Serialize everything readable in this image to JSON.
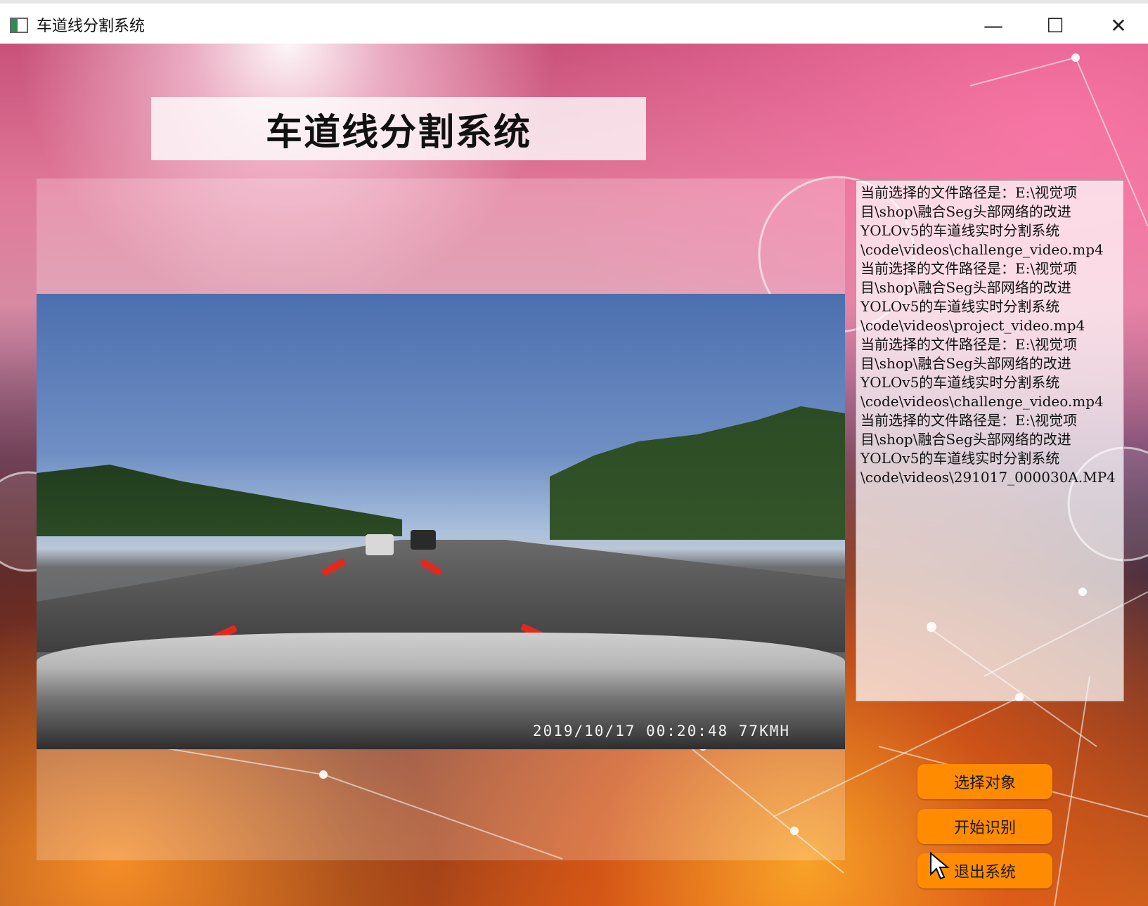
{
  "window": {
    "title": "车道线分割系统",
    "controls": {
      "minimize": "—",
      "maximize": "☐",
      "close": "✕"
    }
  },
  "header": {
    "title": "车道线分割系统"
  },
  "video": {
    "osd": "2019/10/17  00:20:48  77KMH"
  },
  "log": {
    "lines": [
      "当前选择的文件路径是：E:\\视觉项",
      "目\\shop\\融合Seg头部网络的改进",
      "YOLOv5的车道线实时分割系统",
      "\\code\\videos\\challenge_video.mp4",
      "当前选择的文件路径是：E:\\视觉项",
      "目\\shop\\融合Seg头部网络的改进",
      "YOLOv5的车道线实时分割系统",
      "\\code\\videos\\project_video.mp4",
      "当前选择的文件路径是：E:\\视觉项",
      "目\\shop\\融合Seg头部网络的改进",
      "YOLOv5的车道线实时分割系统",
      "\\code\\videos\\challenge_video.mp4",
      "当前选择的文件路径是：E:\\视觉项",
      "目\\shop\\融合Seg头部网络的改进",
      "YOLOv5的车道线实时分割系统",
      "\\code\\videos\\291017_000030A.MP4"
    ]
  },
  "buttons": {
    "select": "选择对象",
    "start": "开始识别",
    "exit": "退出系统"
  },
  "colors": {
    "button_bg": "#ff8c00",
    "lane_mark": "#e3281e"
  }
}
